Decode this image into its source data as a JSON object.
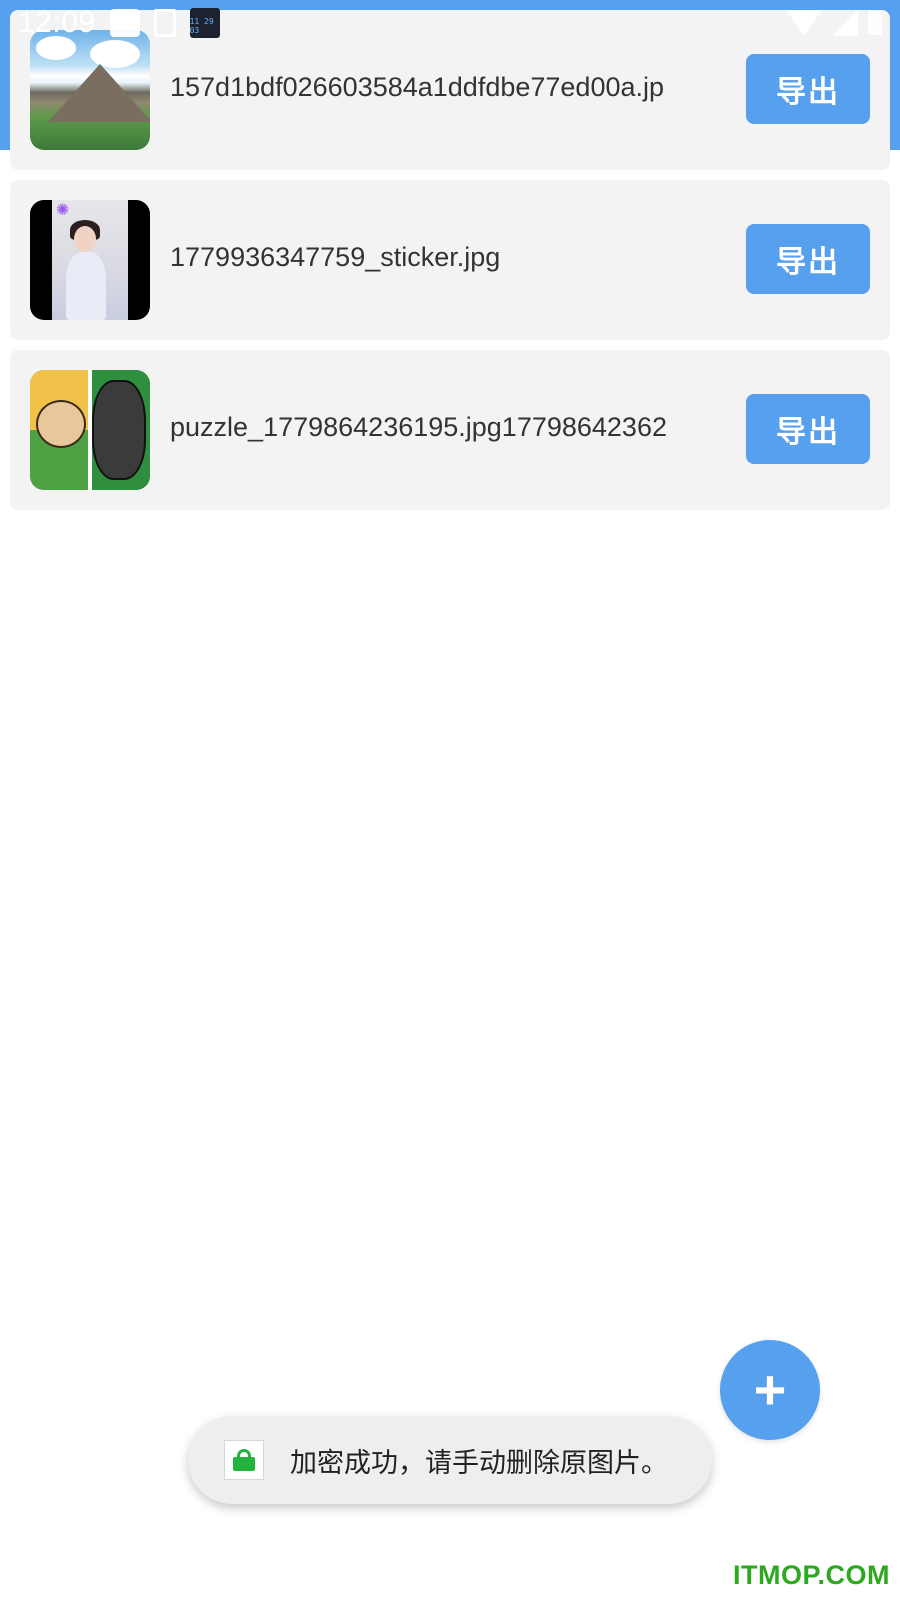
{
  "status_bar": {
    "time": "12:09",
    "notification_app_text": "11 29 03"
  },
  "files": [
    {
      "name": "157d1bdf026603584a1ddfdbe77ed00a.jp",
      "export_label": "导出",
      "thumbnail_icon": "mountain-landscape-image"
    },
    {
      "name": "1779936347759_sticker.jpg",
      "export_label": "导出",
      "thumbnail_icon": "portrait-sticker-image"
    },
    {
      "name": "puzzle_1779864236195.jpg17798642362",
      "export_label": "导出",
      "thumbnail_icon": "cartoon-bears-puzzle-image"
    }
  ],
  "fab": {
    "label": "+"
  },
  "toast": {
    "message": "加密成功，请手动删除原图片。",
    "icon": "lock-icon"
  },
  "watermark": "ITMOP.COM",
  "colors": {
    "accent": "#56a0ee",
    "card_background": "#f3f3f4",
    "toast_background": "#eeeef1",
    "lock_green": "#21b33b",
    "watermark_green": "#2ea81e"
  }
}
